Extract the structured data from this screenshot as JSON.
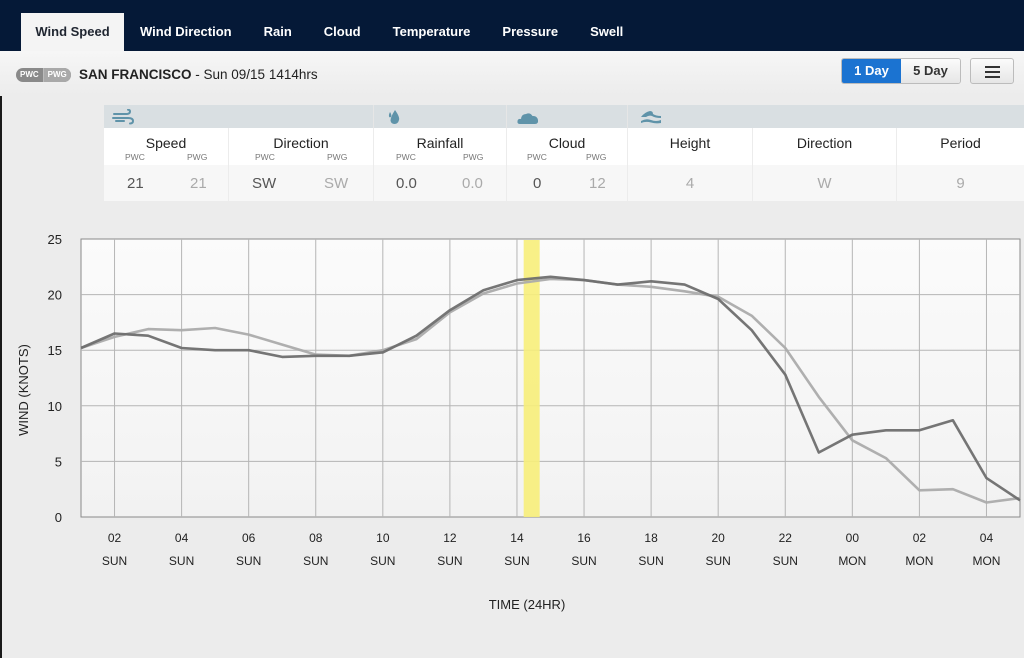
{
  "tabs": [
    {
      "label": "Wind Speed",
      "active": true
    },
    {
      "label": "Wind Direction",
      "active": false
    },
    {
      "label": "Rain",
      "active": false
    },
    {
      "label": "Cloud",
      "active": false
    },
    {
      "label": "Temperature",
      "active": false
    },
    {
      "label": "Pressure",
      "active": false
    },
    {
      "label": "Swell",
      "active": false
    }
  ],
  "header": {
    "badge_left": "PWC",
    "badge_right": "PWG",
    "location": "SAN FRANCISCO",
    "datetime": " - Sun 09/15 1414hrs",
    "range_buttons": [
      {
        "label": "1 Day",
        "active": true
      },
      {
        "label": "5 Day",
        "active": false
      }
    ],
    "menu_icon": "hamburger-icon"
  },
  "summary": {
    "groups": [
      {
        "icon": "wind-icon",
        "columns": [
          {
            "label": "Speed",
            "sub": [
              "PWC",
              "PWG"
            ],
            "values": [
              "21",
              "21"
            ]
          },
          {
            "label": "Direction",
            "sub": [
              "PWC",
              "PWG"
            ],
            "values": [
              "SW",
              "SW"
            ]
          }
        ]
      },
      {
        "icon": "raindrop-icon",
        "columns": [
          {
            "label": "Rainfall",
            "sub": [
              "PWC",
              "PWG"
            ],
            "values": [
              "0.0",
              "0.0"
            ]
          }
        ]
      },
      {
        "icon": "cloud-icon",
        "columns": [
          {
            "label": "Cloud",
            "sub": [
              "PWC",
              "PWG"
            ],
            "values": [
              "0",
              "12"
            ]
          }
        ]
      },
      {
        "icon": "swell-wave-icon",
        "columns": [
          {
            "label": "Height",
            "values": [
              "4"
            ]
          },
          {
            "label": "Direction",
            "values": [
              "W"
            ]
          },
          {
            "label": "Period",
            "values": [
              "9"
            ]
          }
        ]
      }
    ]
  },
  "chart_data": {
    "type": "line",
    "title": "",
    "xlabel": "TIME (24HR)",
    "ylabel": "WIND (KNOTS)",
    "ylim": [
      0,
      25
    ],
    "yticks": [
      0,
      5,
      10,
      15,
      20,
      25
    ],
    "x_hours": [
      1,
      2,
      3,
      4,
      5,
      6,
      7,
      8,
      9,
      10,
      11,
      12,
      13,
      14,
      15,
      16,
      17,
      18,
      19,
      20,
      21,
      22,
      23,
      24,
      25,
      26,
      27,
      28,
      29
    ],
    "xlim_hours": [
      1,
      29
    ],
    "xticks": [
      {
        "hour": 2,
        "label": "02",
        "day": "SUN"
      },
      {
        "hour": 4,
        "label": "04",
        "day": "SUN"
      },
      {
        "hour": 6,
        "label": "06",
        "day": "SUN"
      },
      {
        "hour": 8,
        "label": "08",
        "day": "SUN"
      },
      {
        "hour": 10,
        "label": "10",
        "day": "SUN"
      },
      {
        "hour": 12,
        "label": "12",
        "day": "SUN"
      },
      {
        "hour": 14,
        "label": "14",
        "day": "SUN"
      },
      {
        "hour": 16,
        "label": "16",
        "day": "SUN"
      },
      {
        "hour": 18,
        "label": "18",
        "day": "SUN"
      },
      {
        "hour": 20,
        "label": "20",
        "day": "SUN"
      },
      {
        "hour": 22,
        "label": "22",
        "day": "SUN"
      },
      {
        "hour": 24,
        "label": "00",
        "day": "MON"
      },
      {
        "hour": 26,
        "label": "02",
        "day": "MON"
      },
      {
        "hour": 28,
        "label": "04",
        "day": "MON"
      }
    ],
    "series": [
      {
        "name": "PWC",
        "color": "#6e6e6e",
        "values": [
          15.2,
          16.5,
          16.3,
          15.2,
          15.0,
          15.0,
          14.4,
          14.5,
          14.5,
          14.8,
          16.3,
          18.6,
          20.4,
          21.3,
          21.6,
          21.3,
          20.9,
          21.2,
          20.9,
          19.6,
          16.8,
          12.8,
          5.8,
          7.4,
          7.8,
          7.8,
          8.7,
          3.5,
          1.5
        ]
      },
      {
        "name": "PWG",
        "color": "#ababab",
        "values": [
          15.2,
          16.2,
          16.9,
          16.8,
          17.0,
          16.4,
          15.5,
          14.6,
          14.5,
          15.0,
          16.0,
          18.4,
          20.1,
          21.0,
          21.4,
          21.3,
          20.9,
          20.7,
          20.3,
          19.8,
          18.1,
          15.2,
          10.8,
          6.9,
          5.3,
          2.4,
          2.5,
          1.3,
          1.7
        ]
      }
    ],
    "highlight": {
      "hour": 14.23,
      "label": "current time",
      "color": "#f7ee7a"
    },
    "grid": true,
    "legend": "none"
  }
}
